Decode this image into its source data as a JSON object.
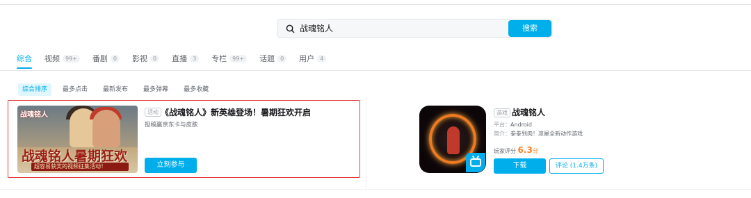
{
  "search": {
    "query": "战魂铭人",
    "button_label": "搜索"
  },
  "tabs": [
    {
      "label": "综合",
      "count": ""
    },
    {
      "label": "视频",
      "count": "99+"
    },
    {
      "label": "番剧",
      "count": "0"
    },
    {
      "label": "影视",
      "count": "0"
    },
    {
      "label": "直播",
      "count": "3"
    },
    {
      "label": "专栏",
      "count": "99+"
    },
    {
      "label": "话题",
      "count": "0"
    },
    {
      "label": "用户",
      "count": "4"
    }
  ],
  "sort_options": [
    "综合排序",
    "最多点击",
    "最新发布",
    "最多弹幕",
    "最多收藏"
  ],
  "activity": {
    "tag": "活动",
    "title": "《战魂铭人》新英雄登场！暑期狂欢开启",
    "subtitle": "投稿赢京东卡与皮肤",
    "button_label": "立刻参与",
    "banner": {
      "logo_text": "战魂铭人",
      "headline": "战魂铭人暑期狂欢",
      "subline": "超容易获奖的视频征集活动！"
    }
  },
  "game": {
    "tag": "游戏",
    "name": "战魂铭人",
    "platform_label": "平台：",
    "platform": "Android",
    "intro_label": "简介：",
    "intro": "拳拳到肉！凉屋全新动作游戏",
    "score_label": "玩家评分",
    "score": "6.3",
    "score_unit": "分",
    "download_label": "下载",
    "review_label": "评论 (1.4万条)"
  },
  "colors": {
    "accent": "#00aeec",
    "highlight_outline": "#e4393c",
    "score": "#ff7f24"
  },
  "icons": {
    "search": "search-icon",
    "bilibili_badge": "bilibili-tv-icon"
  }
}
